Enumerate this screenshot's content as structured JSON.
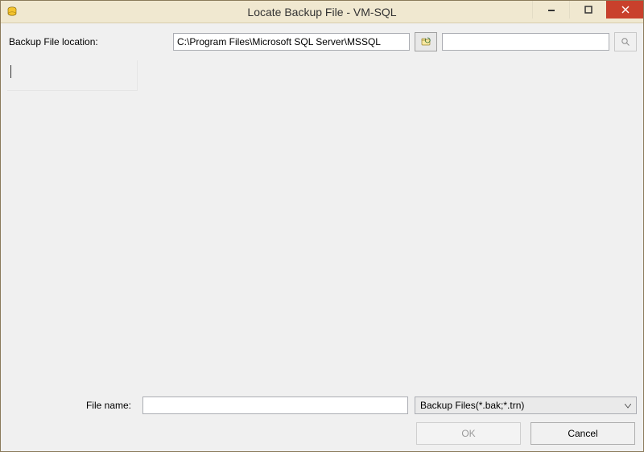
{
  "window": {
    "title": "Locate Backup File - VM-SQL"
  },
  "top": {
    "location_label": "Backup File location:",
    "path_value": "C:\\Program Files\\Microsoft SQL Server\\MSSQL",
    "search_value": ""
  },
  "tree": {
    "content": ""
  },
  "bottom": {
    "filename_label": "File name:",
    "filename_value": "",
    "filter_selected": "Backup Files(*.bak;*.trn)"
  },
  "buttons": {
    "ok": "OK",
    "cancel": "Cancel"
  }
}
